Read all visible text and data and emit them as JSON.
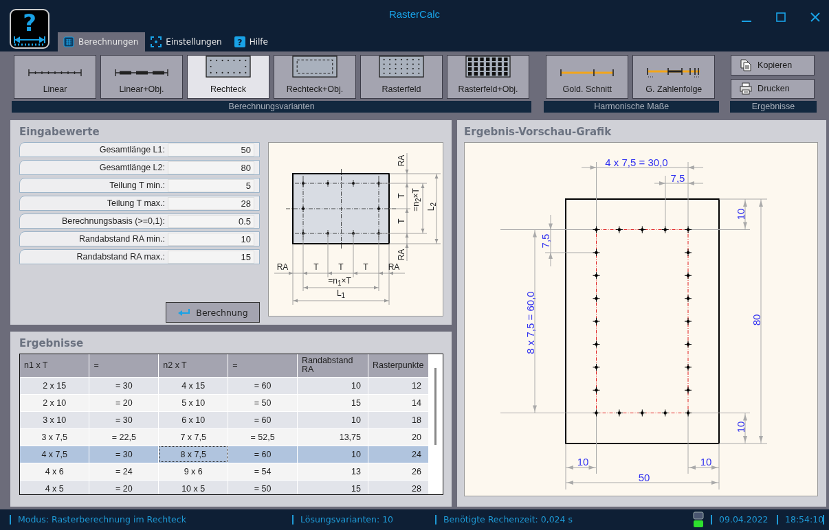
{
  "window": {
    "title": "RasterCalc",
    "logo_glyph": "?"
  },
  "menu_tabs": [
    {
      "label": "Berechnungen",
      "selected": true,
      "kind": "table"
    },
    {
      "label": "Einstellungen",
      "selected": false,
      "kind": "frame"
    },
    {
      "label": "Hilfe",
      "selected": false,
      "kind": "help",
      "glyph": "?"
    }
  ],
  "ribbon": {
    "groups": [
      {
        "label": "Berechnungsvarianten",
        "buttons": [
          {
            "label": "Linear",
            "kind": "linear",
            "selected": false
          },
          {
            "label": "Linear+Obj.",
            "kind": "linear_obj",
            "selected": false
          },
          {
            "label": "Rechteck",
            "kind": "rect",
            "selected": true
          },
          {
            "label": "Rechteck+Obj.",
            "kind": "rect_obj",
            "selected": false
          },
          {
            "label": "Rasterfeld",
            "kind": "grid",
            "selected": false
          },
          {
            "label": "Rasterfeld+Obj.",
            "kind": "grid_obj",
            "selected": false
          }
        ]
      },
      {
        "label": "Harmonische Maße",
        "buttons": [
          {
            "label": "Gold. Schnitt",
            "kind": "golden",
            "selected": false
          },
          {
            "label": "G. Zahlenfolge",
            "kind": "fib",
            "selected": false
          }
        ]
      },
      {
        "label": "Ergebnisse",
        "buttons": [
          {
            "label": "Kopieren",
            "kind": "copy"
          },
          {
            "label": "Drucken",
            "kind": "print"
          }
        ]
      }
    ]
  },
  "input_panel": {
    "title": "Eingabewerte",
    "fields": [
      {
        "label": "Gesamtlänge L1:",
        "value": "50"
      },
      {
        "label": "Gesamtlänge L2:",
        "value": "80"
      },
      {
        "label": "Teilung T min.:",
        "value": "5"
      },
      {
        "label": "Teilung T max.:",
        "value": "28"
      },
      {
        "label": "Berechnungsbasis (>=0,1):",
        "value": "0.5"
      },
      {
        "label": "Randabstand RA min.:",
        "value": "10"
      },
      {
        "label": "Randabstand RA max.:",
        "value": "15"
      }
    ],
    "button": "Berechnung",
    "schematic_labels": [
      "RA",
      "T",
      "T",
      "=n$_{2}$×T",
      "L$_{2}$",
      "RA",
      "RA",
      "T",
      "T",
      "T",
      "RA",
      "=n$_{1}$×T",
      "L$_{1}$"
    ]
  },
  "results": {
    "title": "Ergebnisse",
    "columns": [
      "n1 x T",
      "=",
      "n2 x T",
      "=",
      "Randabstand RA",
      "Rasterpunkte"
    ],
    "rows": [
      {
        "selected": false,
        "cells": [
          {
            "text": "2 x 15",
            "focused": false
          },
          {
            "text": "= 30",
            "focused": false
          },
          {
            "text": "4 x 15",
            "focused": false
          },
          {
            "text": "= 60",
            "focused": false
          },
          {
            "text": "10",
            "focused": false
          },
          {
            "text": "12",
            "focused": false
          }
        ]
      },
      {
        "selected": false,
        "cells": [
          {
            "text": "2 x 10",
            "focused": false
          },
          {
            "text": "= 20",
            "focused": false
          },
          {
            "text": "5 x 10",
            "focused": false
          },
          {
            "text": "= 50",
            "focused": false
          },
          {
            "text": "15",
            "focused": false
          },
          {
            "text": "14",
            "focused": false
          }
        ]
      },
      {
        "selected": false,
        "cells": [
          {
            "text": "3 x 10",
            "focused": false
          },
          {
            "text": "= 30",
            "focused": false
          },
          {
            "text": "6 x 10",
            "focused": false
          },
          {
            "text": "= 60",
            "focused": false
          },
          {
            "text": "10",
            "focused": false
          },
          {
            "text": "18",
            "focused": false
          }
        ]
      },
      {
        "selected": false,
        "cells": [
          {
            "text": "3 x 7,5",
            "focused": false
          },
          {
            "text": "= 22,5",
            "focused": false
          },
          {
            "text": "7 x 7,5",
            "focused": false
          },
          {
            "text": "= 52,5",
            "focused": false
          },
          {
            "text": "13,75",
            "focused": false
          },
          {
            "text": "20",
            "focused": false
          }
        ]
      },
      {
        "selected": true,
        "cells": [
          {
            "text": "4 x 7,5",
            "focused": false
          },
          {
            "text": "= 30",
            "focused": false
          },
          {
            "text": "8 x 7,5",
            "focused": true
          },
          {
            "text": "= 60",
            "focused": false
          },
          {
            "text": "10",
            "focused": false
          },
          {
            "text": "24",
            "focused": false
          }
        ]
      },
      {
        "selected": false,
        "cells": [
          {
            "text": "4 x 6",
            "focused": false
          },
          {
            "text": "= 24",
            "focused": false
          },
          {
            "text": "9 x 6",
            "focused": false
          },
          {
            "text": "= 54",
            "focused": false
          },
          {
            "text": "13",
            "focused": false
          },
          {
            "text": "26",
            "focused": false
          }
        ]
      },
      {
        "selected": false,
        "cells": [
          {
            "text": "4 x 5",
            "focused": false
          },
          {
            "text": "= 20",
            "focused": false
          },
          {
            "text": "10 x 5",
            "focused": false
          },
          {
            "text": "= 50",
            "focused": false
          },
          {
            "text": "15",
            "focused": false
          },
          {
            "text": "28",
            "focused": false
          }
        ]
      }
    ]
  },
  "preview": {
    "title": "Ergebnis-Vorschau-Grafik",
    "dimension_labels": [
      "4 x 7,5 = 30,0",
      "7,5",
      "10",
      "80",
      "10",
      "7,5",
      "8 x 7,5 = 60,0",
      "10",
      "10",
      "50"
    ]
  },
  "status_bar": {
    "mode": "Modus: Rasterberechnung im Rechteck",
    "variants": "Lösungsvarianten: 10",
    "time": "Benötigte Rechenzeit: 0,024 s",
    "date": "09.04.2022",
    "clock": "18:54:10"
  }
}
